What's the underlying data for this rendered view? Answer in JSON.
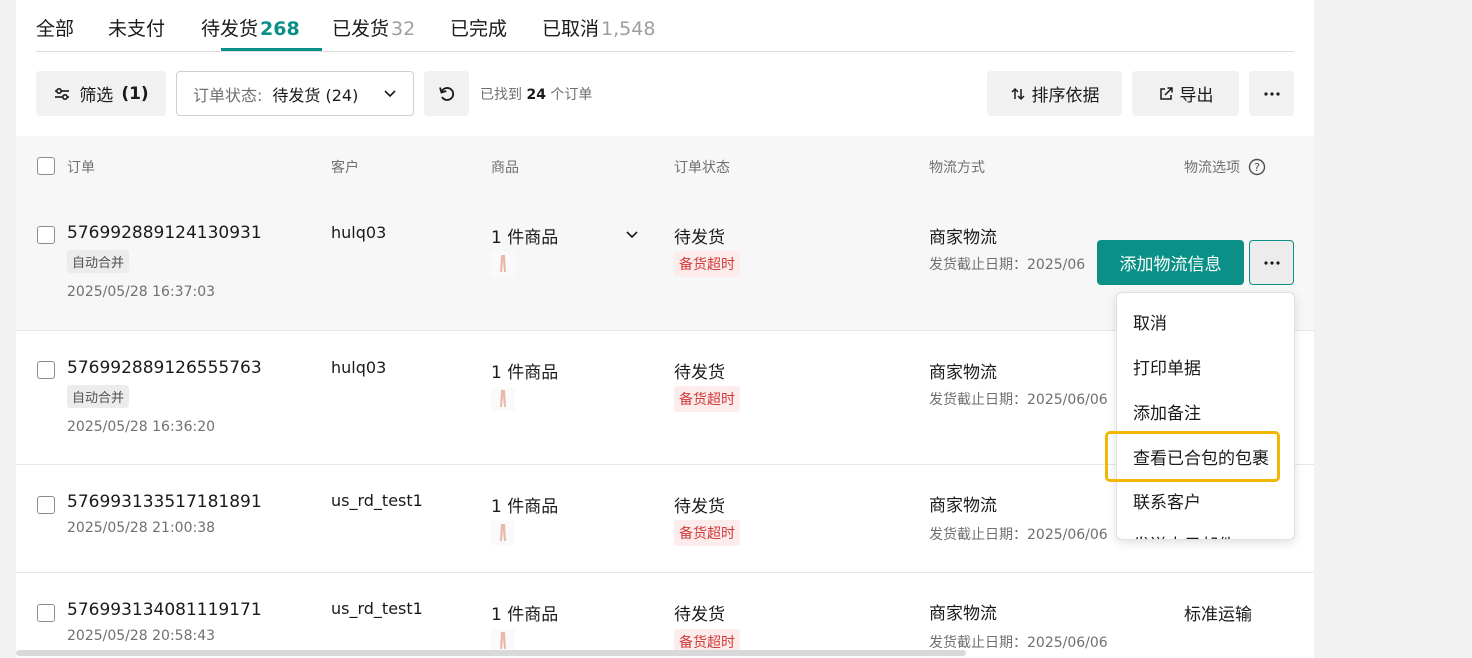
{
  "tabs": [
    {
      "label": "全部",
      "count": ""
    },
    {
      "label": "未支付",
      "count": ""
    },
    {
      "label": "待发货",
      "count": "268"
    },
    {
      "label": "已发货",
      "count": "32"
    },
    {
      "label": "已完成",
      "count": ""
    },
    {
      "label": "已取消",
      "count": "1,548"
    }
  ],
  "active_tab": "待发货",
  "toolbar": {
    "filter_label": "筛选",
    "filter_count": "(1)",
    "status_select_label": "订单状态:",
    "status_select_value": "待发货 (24)",
    "found_prefix": "已找到",
    "found_count": "24",
    "found_suffix": "个订单",
    "sort_label": "排序依据",
    "export_label": "导出"
  },
  "table": {
    "headers": {
      "order": "订单",
      "customer": "客户",
      "product": "商品",
      "status": "订单状态",
      "shipping": "物流方式",
      "shipping_option": "物流选项"
    },
    "rows": [
      {
        "order_id": "576992889124130931",
        "tag": "自动合并",
        "date": "2025/05/28 16:37:03",
        "customer": "hulq03",
        "product": "1 件商品",
        "status": "待发货",
        "badge": "备货超时",
        "shipping": "商家物流",
        "deadline": "发货截止日期：2025/06",
        "option": ""
      },
      {
        "order_id": "576992889126555763",
        "tag": "自动合并",
        "date": "2025/05/28 16:36:20",
        "customer": "hulq03",
        "product": "1 件商品",
        "status": "待发货",
        "badge": "备货超时",
        "shipping": "商家物流",
        "deadline": "发货截止日期：2025/06/06",
        "option": ""
      },
      {
        "order_id": "576993133517181891",
        "tag": "",
        "date": "2025/05/28 21:00:38",
        "customer": "us_rd_test1",
        "product": "1 件商品",
        "status": "待发货",
        "badge": "备货超时",
        "shipping": "商家物流",
        "deadline": "发货截止日期：2025/06/06",
        "option": ""
      },
      {
        "order_id": "576993134081119171",
        "tag": "",
        "date": "2025/05/28 20:58:43",
        "customer": "us_rd_test1",
        "product": "1 件商品",
        "status": "待发货",
        "badge": "备货超时",
        "shipping": "商家物流",
        "deadline": "发货截止日期：2025/06/06",
        "option": "标准运输"
      }
    ]
  },
  "row_actions": {
    "primary_label": "添加物流信息"
  },
  "dropdown_menu": {
    "items": [
      "取消",
      "打印单据",
      "添加备注",
      "查看已合包的包裹",
      "联系客户",
      "发送电子邮件"
    ],
    "highlighted": "查看已合包的包裹"
  },
  "colors": {
    "accent": "#0a9087",
    "highlight_border": "#f2b705",
    "badge_text": "#d23a3a",
    "badge_bg": "#fdecec"
  },
  "icons": [
    "filter-icon",
    "chevron-down-icon",
    "refresh-icon",
    "sort-icon",
    "export-icon",
    "more-icon",
    "help-icon"
  ]
}
